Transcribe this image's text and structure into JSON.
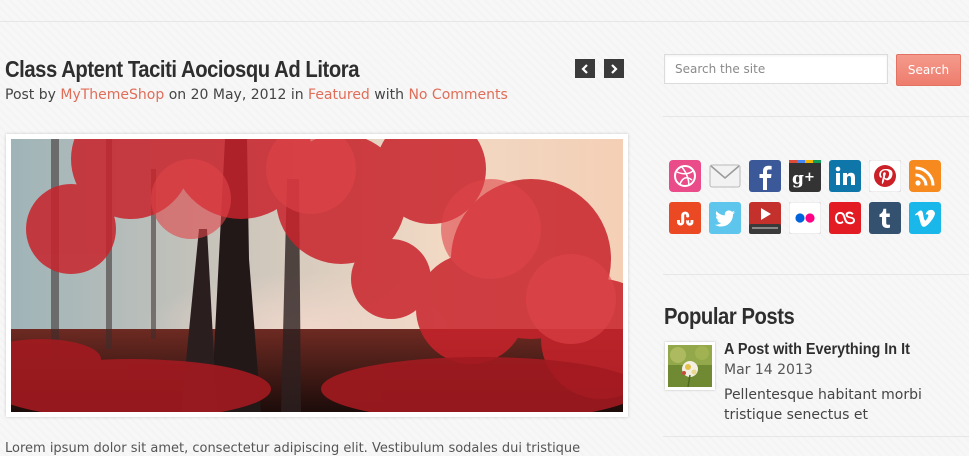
{
  "post": {
    "title": "Class Aptent Taciti Aociosqu Ad Litora",
    "meta_prefix": "Post by",
    "author": "MyThemeShop",
    "date_prefix": "on",
    "date": "20 May, 2012",
    "category_prefix": "in",
    "category": "Featured",
    "comments_prefix": "with",
    "comments": "No Comments",
    "body_cutoff": "Lorem ipsum dolor sit amet, consectetur adipiscing elit. Vestibulum sodales dui tristique"
  },
  "nav": {
    "prev_icon": "chevron-left-icon",
    "next_icon": "chevron-right-icon"
  },
  "search": {
    "placeholder": "Search the site",
    "button_label": "Search"
  },
  "social": {
    "row1": [
      "dribbble",
      "email",
      "facebook",
      "google-plus",
      "linkedin",
      "pinterest",
      "rss"
    ],
    "row2": [
      "stumbleupon",
      "twitter",
      "youtube",
      "flickr",
      "lastfm",
      "tumblr",
      "vimeo"
    ]
  },
  "popular": {
    "heading": "Popular Posts",
    "items": [
      {
        "title": "A Post with Everything In It",
        "date": "Mar 14 2013",
        "excerpt": "Pellentesque habitant morbi tristique senectus et"
      }
    ]
  },
  "colors": {
    "accent": "#e06d58",
    "button": "#f1897a",
    "heading": "#2e2e2e"
  }
}
